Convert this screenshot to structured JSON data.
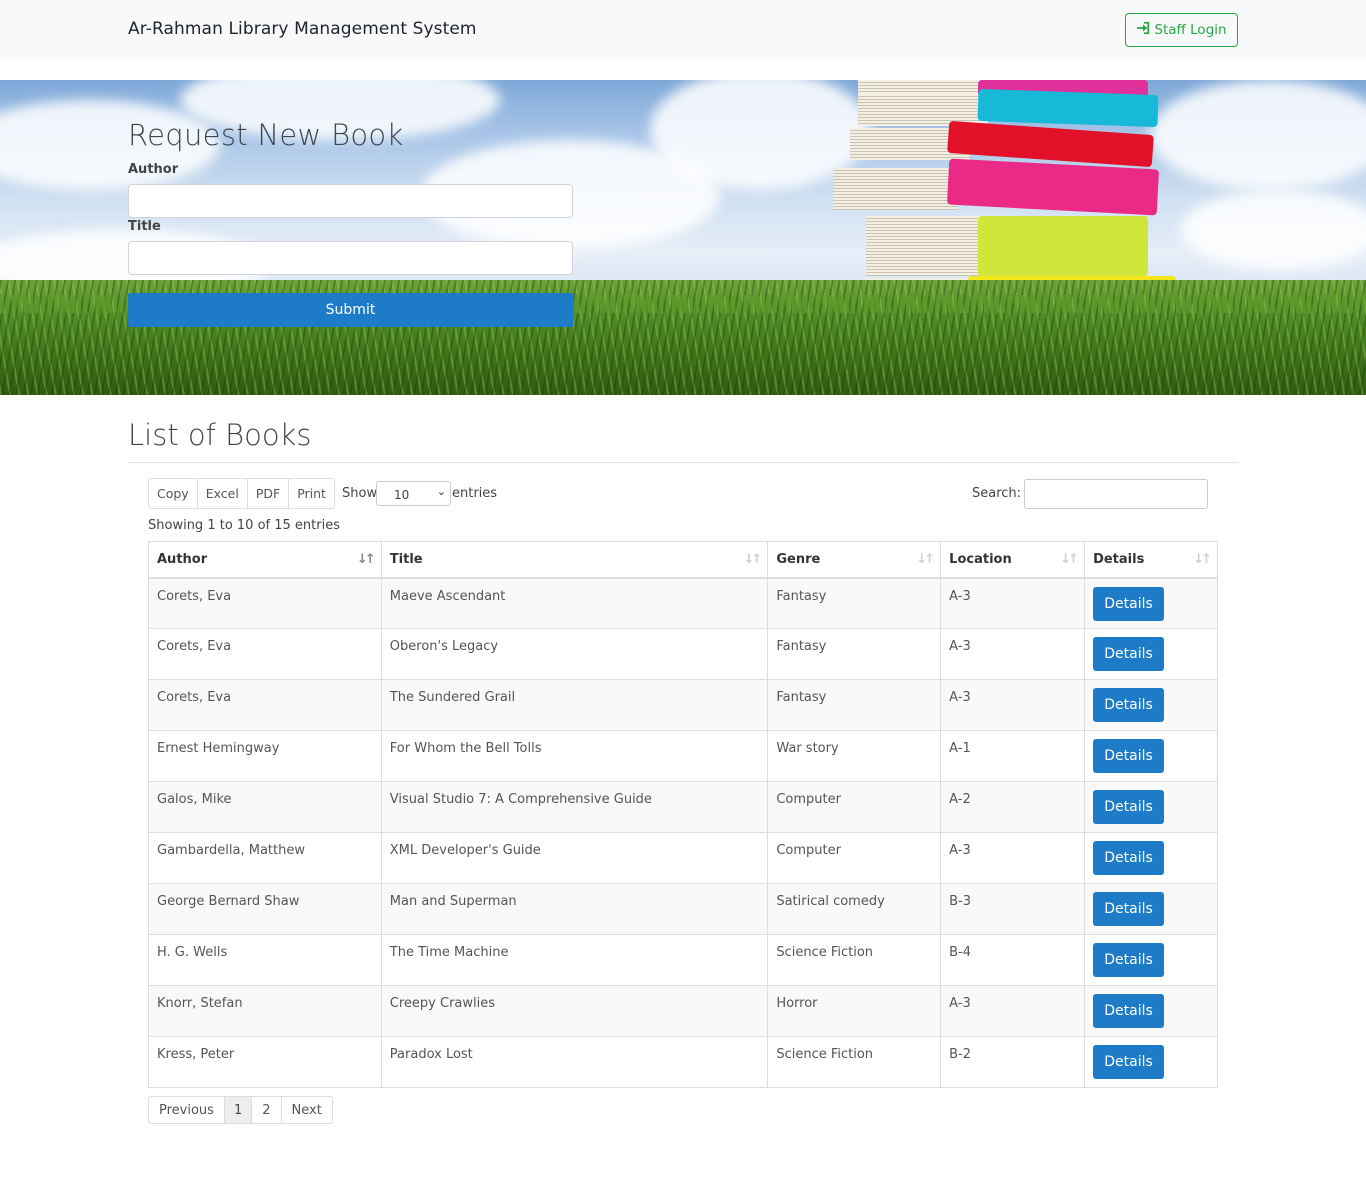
{
  "navbar": {
    "brand": "Ar-Rahman Library Management System",
    "staff_login_label": "Staff Login",
    "accent_color": "#28a745"
  },
  "request_form": {
    "title": "Request New Book",
    "author_label": "Author",
    "author_value": "",
    "title_label": "Title",
    "title_value": "",
    "submit_label": "Submit",
    "submit_color": "#1e7bc7"
  },
  "books_list": {
    "heading": "List of Books",
    "export_buttons": [
      "Copy",
      "Excel",
      "PDF",
      "Print"
    ],
    "show_label": "Show",
    "page_length": "10",
    "entries_label": "entries",
    "search_label": "Search:",
    "search_value": "",
    "info": "Showing 1 to 10 of 15 entries",
    "columns": [
      "Author",
      "Title",
      "Genre",
      "Location",
      "Details"
    ],
    "sorted_column": "Author",
    "details_label": "Details",
    "rows": [
      {
        "author": "Corets, Eva",
        "title": "Maeve Ascendant",
        "genre": "Fantasy",
        "location": "A-3"
      },
      {
        "author": "Corets, Eva",
        "title": "Oberon's Legacy",
        "genre": "Fantasy",
        "location": "A-3"
      },
      {
        "author": "Corets, Eva",
        "title": "The Sundered Grail",
        "genre": "Fantasy",
        "location": "A-3"
      },
      {
        "author": "Ernest Hemingway",
        "title": "For Whom the Bell Tolls",
        "genre": "War story",
        "location": "A-1"
      },
      {
        "author": "Galos, Mike",
        "title": "Visual Studio 7: A Comprehensive Guide",
        "genre": "Computer",
        "location": "A-2"
      },
      {
        "author": "Gambardella, Matthew",
        "title": "XML Developer's Guide",
        "genre": "Computer",
        "location": "A-3"
      },
      {
        "author": "George Bernard Shaw",
        "title": "Man and Superman",
        "genre": "Satirical comedy",
        "location": "B-3"
      },
      {
        "author": "H. G. Wells",
        "title": "The Time Machine",
        "genre": "Science Fiction",
        "location": "B-4"
      },
      {
        "author": "Knorr, Stefan",
        "title": "Creepy Crawlies",
        "genre": "Horror",
        "location": "A-3"
      },
      {
        "author": "Kress, Peter",
        "title": "Paradox Lost",
        "genre": "Science Fiction",
        "location": "B-2"
      }
    ],
    "pagination": {
      "previous": "Previous",
      "pages": [
        "1",
        "2"
      ],
      "current": "1",
      "next": "Next"
    }
  }
}
